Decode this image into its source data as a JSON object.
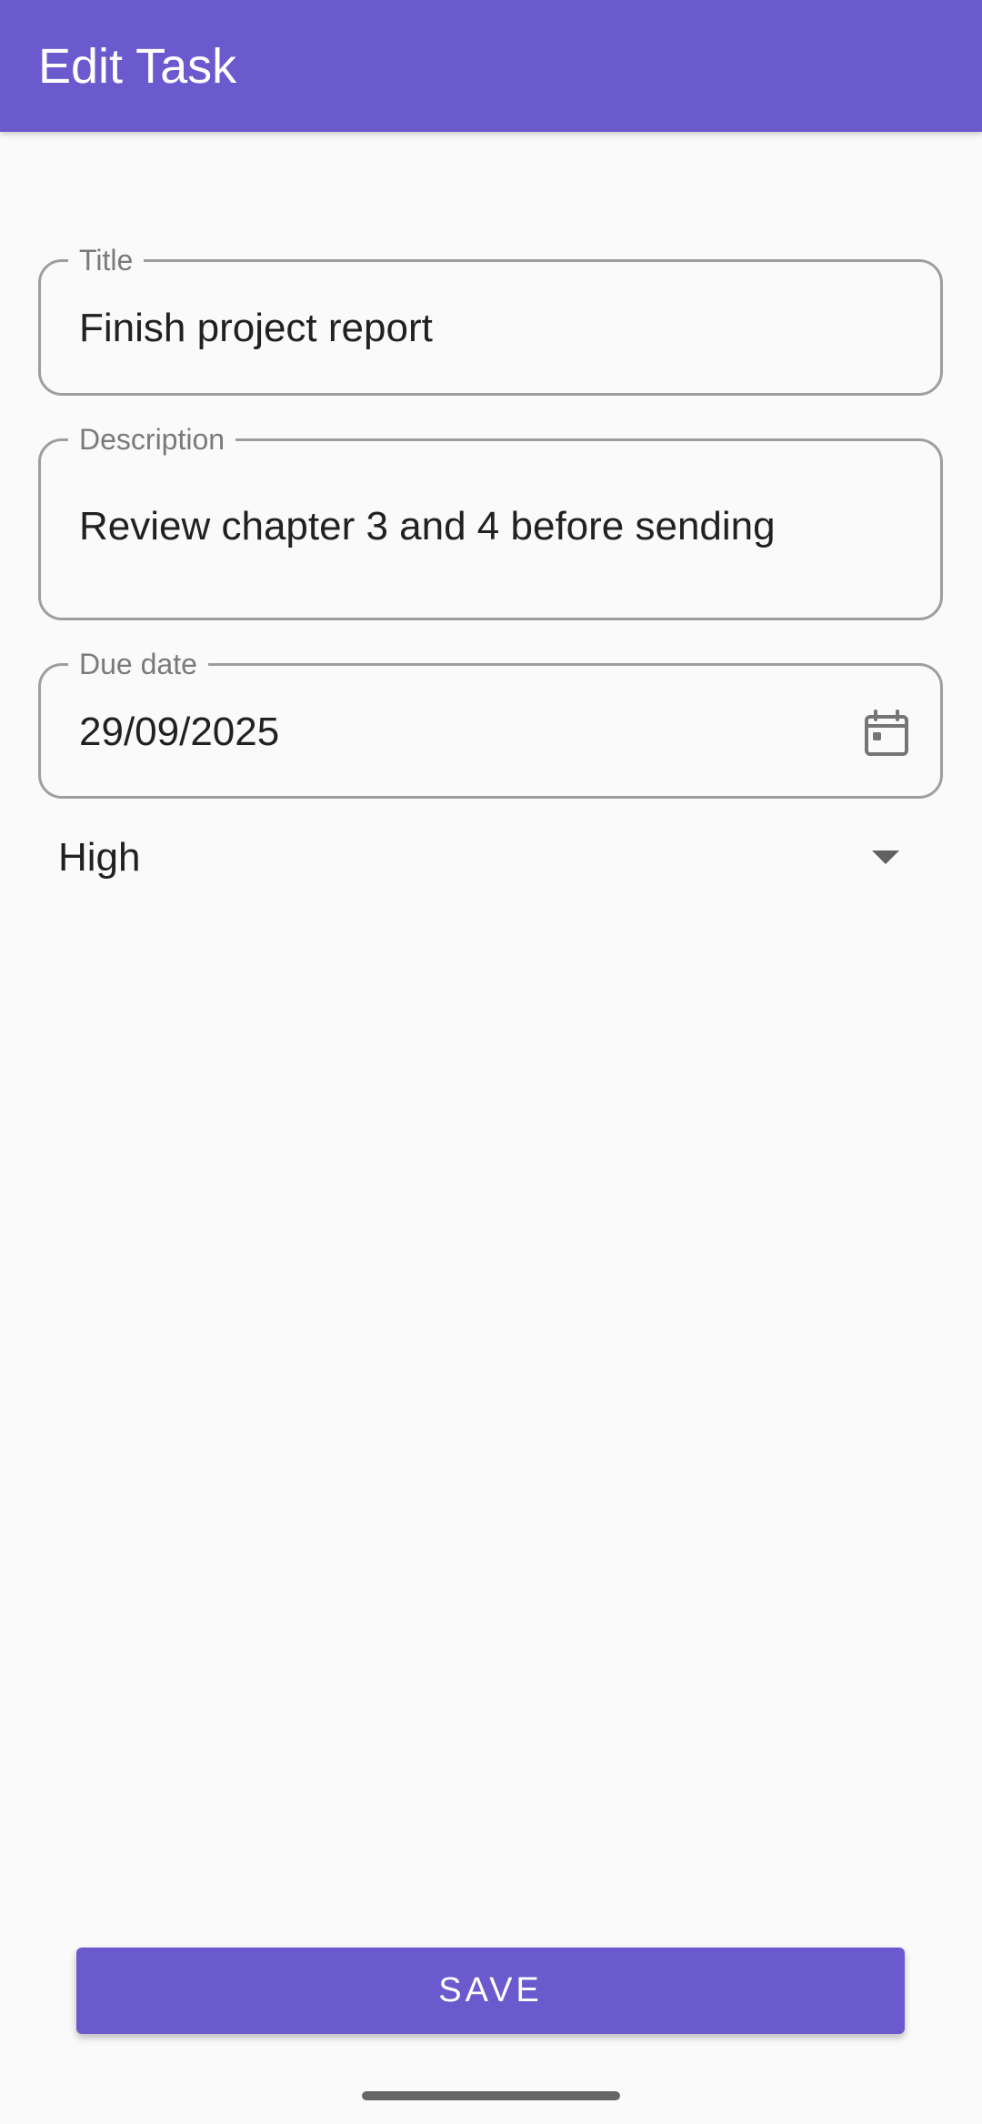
{
  "app_bar": {
    "title": "Edit Task",
    "color": "#6a5acd"
  },
  "form": {
    "title_field": {
      "label": "Title",
      "value": "Finish project report"
    },
    "description_field": {
      "label": "Description",
      "value": "Review chapter 3 and 4 before sending"
    },
    "due_date_field": {
      "label": "Due date",
      "value": "29/09/2025",
      "trailing_icon": "calendar-icon"
    },
    "priority_select": {
      "selected": "High",
      "trailing_icon": "dropdown-arrow-icon"
    }
  },
  "save_button": {
    "label": "SAVE",
    "color": "#6a5acd"
  },
  "system": {
    "navigation": "gesture-bar"
  }
}
